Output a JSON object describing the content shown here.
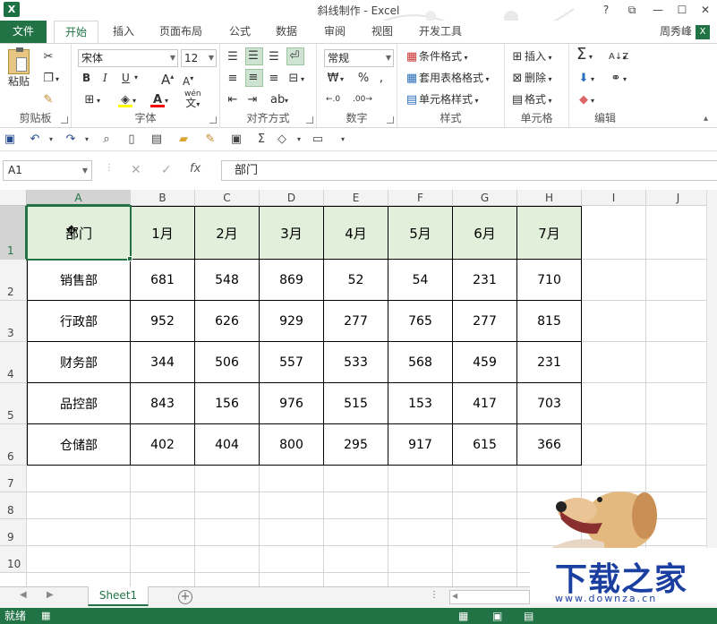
{
  "window": {
    "title": "斜线制作 - Excel",
    "help": "?",
    "restore": "⧉",
    "minimize": "—",
    "maximize": "☐",
    "close": "✕"
  },
  "ribbon_tabs": [
    {
      "label": "文件"
    },
    {
      "label": "开始"
    },
    {
      "label": "插入"
    },
    {
      "label": "页面布局"
    },
    {
      "label": "公式"
    },
    {
      "label": "数据"
    },
    {
      "label": "审阅"
    },
    {
      "label": "视图"
    },
    {
      "label": "开发工具"
    }
  ],
  "active_tab": "开始",
  "user_name": "周秀峰",
  "groups": {
    "clipboard": {
      "label": "剪贴板",
      "paste": "粘贴"
    },
    "font": {
      "label": "字体",
      "font_name": "宋体",
      "font_size": "12",
      "bold": "B",
      "italic": "I",
      "underline": "U",
      "wen": "wén"
    },
    "alignment": {
      "label": "对齐方式"
    },
    "number": {
      "label": "数字",
      "format": "常规"
    },
    "styles": {
      "label": "样式",
      "conditional": "条件格式",
      "table": "套用表格格式",
      "cell_styles": "单元格样式"
    },
    "cells": {
      "label": "单元格",
      "insert": "插入",
      "delete": "删除",
      "format": "格式"
    },
    "editing": {
      "label": "编辑"
    }
  },
  "formula_bar": {
    "name_box": "A1",
    "formula": "部门"
  },
  "columns": [
    "A",
    "B",
    "C",
    "D",
    "E",
    "F",
    "G",
    "H",
    "I",
    "J"
  ],
  "rows": [
    "1",
    "2",
    "3",
    "4",
    "5",
    "6",
    "7",
    "8",
    "9",
    "10"
  ],
  "table": {
    "header": [
      "部门",
      "1月",
      "2月",
      "3月",
      "4月",
      "5月",
      "6月",
      "7月"
    ],
    "body": [
      [
        "销售部",
        "681",
        "548",
        "869",
        "52",
        "54",
        "231",
        "710"
      ],
      [
        "行政部",
        "952",
        "626",
        "929",
        "277",
        "765",
        "277",
        "815"
      ],
      [
        "财务部",
        "344",
        "506",
        "557",
        "533",
        "568",
        "459",
        "231"
      ],
      [
        "品控部",
        "843",
        "156",
        "976",
        "515",
        "153",
        "417",
        "703"
      ],
      [
        "仓储部",
        "402",
        "404",
        "800",
        "295",
        "917",
        "615",
        "366"
      ]
    ]
  },
  "sheet_tab": "Sheet1",
  "status": "就绪",
  "watermark": {
    "text": "下载之家",
    "url": "www.downza.cn"
  }
}
